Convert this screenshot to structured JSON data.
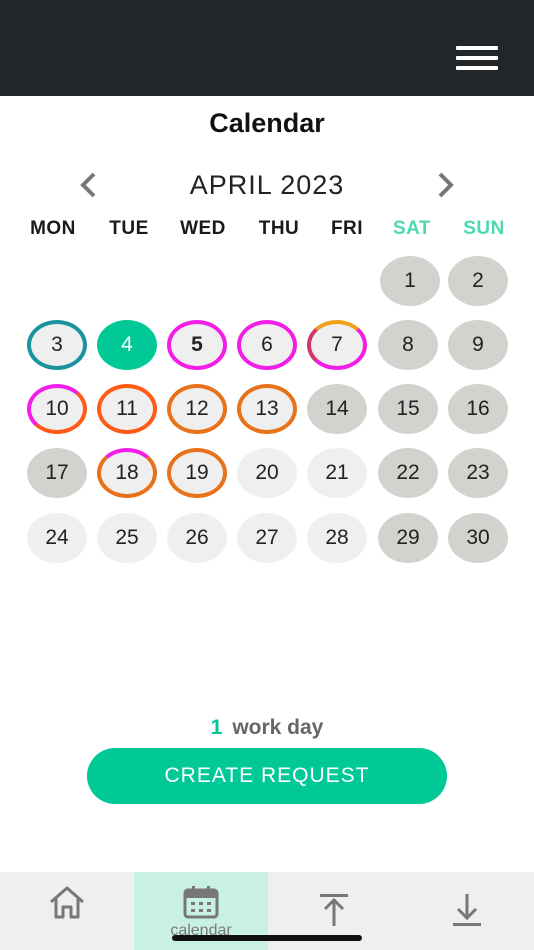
{
  "header": {
    "menu_icon": "hamburger-menu-icon"
  },
  "page_title": "Calendar",
  "calendar": {
    "month_label": "APRIL 2023",
    "weekdays": [
      "MON",
      "TUE",
      "WED",
      "THU",
      "FRI",
      "SAT",
      "SUN"
    ],
    "weekend_color": "#4dd9b0",
    "days": [
      "1",
      "2",
      "3",
      "4",
      "5",
      "6",
      "7",
      "8",
      "9",
      "10",
      "11",
      "12",
      "13",
      "14",
      "15",
      "16",
      "17",
      "18",
      "19",
      "20",
      "21",
      "22",
      "23",
      "24",
      "25",
      "26",
      "27",
      "28",
      "29",
      "30"
    ]
  },
  "summary": {
    "count": "1",
    "label": "work day"
  },
  "create_button": "CREATE REQUEST",
  "bottom_nav": {
    "tabs": [
      {
        "icon": "home-icon",
        "label": ""
      },
      {
        "icon": "calendar-icon",
        "label": "calendar"
      },
      {
        "icon": "upload-icon",
        "label": ""
      },
      {
        "icon": "download-icon",
        "label": ""
      }
    ]
  },
  "colors": {
    "accent": "#00c896",
    "topbar": "#222628",
    "pink": "#f21ee8",
    "orange": "#e8721a",
    "teal": "#1a939e"
  }
}
